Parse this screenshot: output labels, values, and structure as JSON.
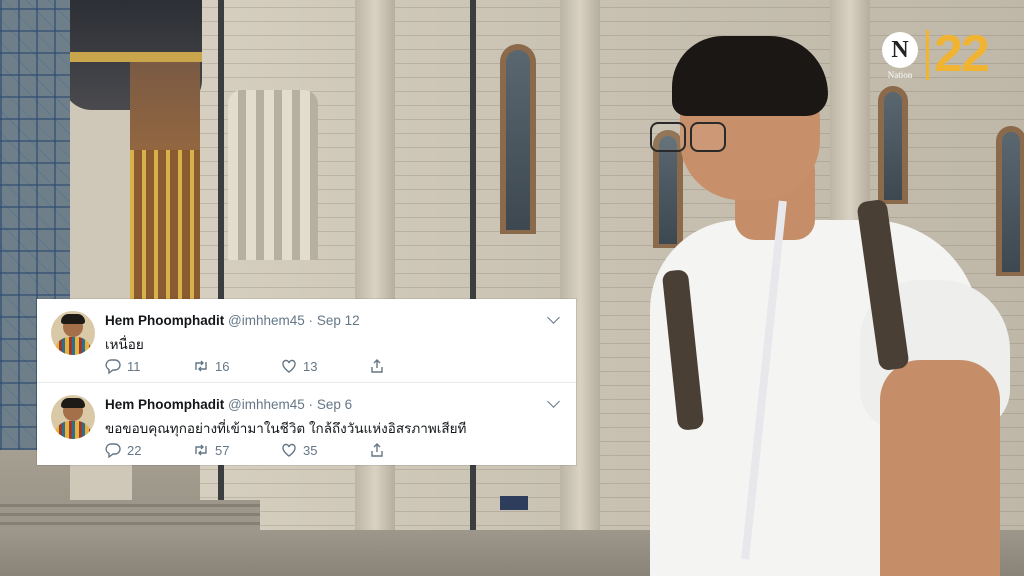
{
  "logo": {
    "letter": "N",
    "word": "Nation",
    "number": "22"
  },
  "tweets": [
    {
      "name": "Hem Phoomphadit",
      "handle": "@imhhem45",
      "separator": "·",
      "date": "Sep 12",
      "text": "เหนื่อย",
      "replies": "11",
      "retweets": "16",
      "likes": "13"
    },
    {
      "name": "Hem Phoomphadit",
      "handle": "@imhhem45",
      "separator": "·",
      "date": "Sep 6",
      "text": "ขอขอบคุณทุกอย่างที่เข้ามาในชีวิต ใกล้ถึงวันแห่งอิสรภาพเสียที",
      "replies": "22",
      "retweets": "57",
      "likes": "35"
    }
  ],
  "icons": [
    "reply-icon",
    "retweet-icon",
    "like-icon",
    "share-icon",
    "chevron-down-icon"
  ],
  "colors": {
    "accent": "#f0b432",
    "muted": "#657786",
    "text": "#14171a"
  }
}
